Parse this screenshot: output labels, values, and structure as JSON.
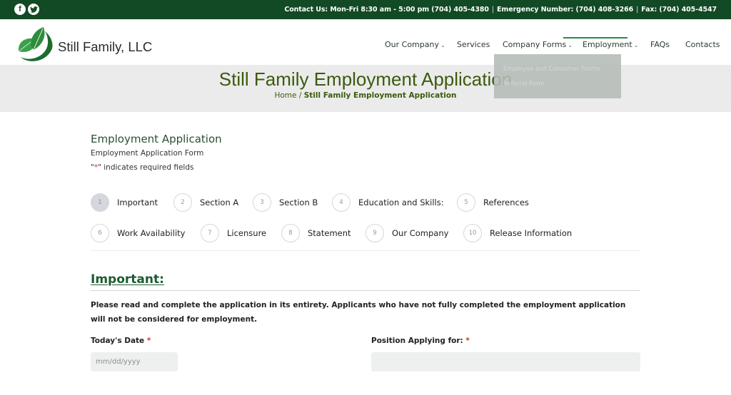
{
  "topbar": {
    "social": [
      {
        "name": "facebook-icon",
        "glyph": "f"
      },
      {
        "name": "twitter-icon",
        "glyph": "t"
      }
    ],
    "contact_hours": "Contact Us: Mon-Fri 8:30 am - 5:00 pm (704) 405-4380",
    "separator": "|",
    "emergency": "Emergency Number: (704) 408-3266",
    "fax": "Fax: (704) 405-4547"
  },
  "header": {
    "brand": "Still Family, LLC",
    "nav": [
      {
        "label": "Our Company",
        "dropdown": true
      },
      {
        "label": "Services",
        "dropdown": false
      },
      {
        "label": "Company Forms",
        "dropdown": true
      },
      {
        "label": "Employment",
        "dropdown": true,
        "active": true
      },
      {
        "label": "FAQs",
        "dropdown": false
      },
      {
        "label": "Contacts",
        "dropdown": false
      }
    ],
    "chevron": "⌄",
    "dropdown_items": [
      "Employee and Consumer Forms",
      "Referral Form"
    ]
  },
  "banner": {
    "title": "Still Family Employment Application",
    "breadcrumb_home": "Home",
    "breadcrumb_sep": " / ",
    "breadcrumb_current": "Still Family Employment Application"
  },
  "form": {
    "title": "Employment Application",
    "subtitle": "Employment Application Form",
    "required_note_prefix": "\"",
    "required_star": "*",
    "required_note_suffix": "\" indicates required fields",
    "steps": [
      {
        "num": "1",
        "label": "Important",
        "active": true
      },
      {
        "num": "2",
        "label": "Section A"
      },
      {
        "num": "3",
        "label": "Section B"
      },
      {
        "num": "4",
        "label": "Education and Skills:"
      },
      {
        "num": "5",
        "label": "References"
      },
      {
        "num": "6",
        "label": "Work Availability"
      },
      {
        "num": "7",
        "label": "Licensure"
      },
      {
        "num": "8",
        "label": "Statement"
      },
      {
        "num": "9",
        "label": "Our Company"
      },
      {
        "num": "10",
        "label": "Release Information"
      }
    ],
    "section_heading": "Important:",
    "intro_text": "Please read and complete the application in its entirety. Applicants who have not fully completed the employment application will not be considered for employment.",
    "fields": {
      "todays_date": {
        "label": "Today's Date",
        "star": "*",
        "placeholder": "mm/dd/yyyy",
        "value": ""
      },
      "position": {
        "label": "Position Applying for:",
        "star": "*",
        "placeholder": "",
        "value": ""
      }
    }
  },
  "colors": {
    "topbar": "#114a24",
    "accent_green": "#2e8b3a",
    "title_green": "#3c5a0f",
    "section_green": "#1d5b2f",
    "required_red": "#c0392b"
  }
}
